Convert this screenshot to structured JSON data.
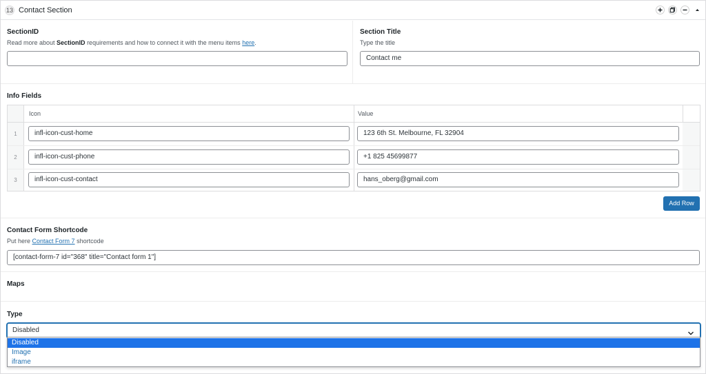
{
  "header": {
    "layout_number": "13",
    "title": "Contact Section",
    "icons": [
      "plus-icon",
      "duplicate-icon",
      "minus-icon",
      "collapse-icon"
    ]
  },
  "section_id": {
    "label": "SectionID",
    "desc_prefix": "Read more about ",
    "desc_bold": "SectionID",
    "desc_middle": " requirements and how to connect it with the menu items ",
    "desc_link": "here",
    "desc_suffix": ".",
    "value": ""
  },
  "section_title": {
    "label": "Section Title",
    "desc": "Type the title",
    "value": "Contact me"
  },
  "info_fields": {
    "label": "Info Fields",
    "columns": [
      "Icon",
      "Value"
    ],
    "rows": [
      {
        "num": "1",
        "icon": "infl-icon-cust-home",
        "value": "123 6th St. Melbourne, FL 32904"
      },
      {
        "num": "2",
        "icon": "infl-icon-cust-phone",
        "value": "+1 825 45699877"
      },
      {
        "num": "3",
        "icon": "infl-icon-cust-contact",
        "value": "hans_oberg@gmail.com"
      }
    ],
    "add_row_label": "Add Row"
  },
  "contact_form": {
    "label": "Contact Form Shortcode",
    "desc_prefix": "Put here ",
    "desc_link": "Contact Form 7",
    "desc_suffix": " shortcode",
    "value": "[contact-form-7 id=\"368\" title=\"Contact form 1\"]"
  },
  "maps": {
    "label": "Maps"
  },
  "type": {
    "label": "Type",
    "selected": "Disabled",
    "options": [
      "Disabled",
      "Image",
      "iframe"
    ]
  },
  "colors": {
    "accent": "#2271b1",
    "option_highlight": "#1e73e8",
    "border": "#8c8f94"
  }
}
